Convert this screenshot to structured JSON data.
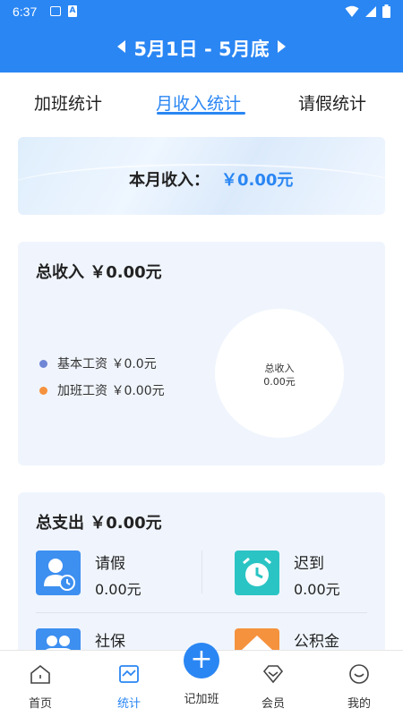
{
  "status_bar": {
    "time": "6:37"
  },
  "header": {
    "prev_icon": "triangle-left-icon",
    "date_range": "5月1日 - 5月底",
    "next_icon": "triangle-right-icon",
    "color": "#2a86f3"
  },
  "tabs": [
    {
      "label": "加班统计",
      "active": false
    },
    {
      "label": "月收入统计",
      "active": true
    },
    {
      "label": "请假统计",
      "active": false
    }
  ],
  "monthly_income": {
    "label": "本月收入：",
    "value": "￥0.00元"
  },
  "total_income": {
    "title": "总收入 ￥0.00元",
    "legend": [
      {
        "label": "基本工资 ￥0.0元",
        "color": "#6f86d6"
      },
      {
        "label": "加班工资 ￥0.00元",
        "color": "#f5923e"
      }
    ],
    "pie_center": {
      "label": "总收入",
      "value": "0.00元"
    }
  },
  "total_expense": {
    "title": "总支出 ￥0.00元",
    "items": [
      {
        "name": "请假",
        "amount": "0.00元",
        "icon": "person-clock-icon",
        "color": "#3d8ff0"
      },
      {
        "name": "迟到",
        "amount": "0.00元",
        "icon": "alarm-clock-icon",
        "color": "#2bc4c4"
      },
      {
        "name": "社保",
        "amount": "",
        "icon": "people-icon",
        "color": "#3d8ff0"
      },
      {
        "name": "公积金",
        "amount": "",
        "icon": "house-icon",
        "color": "#f5923e"
      }
    ]
  },
  "bottom_nav": {
    "items": [
      {
        "label": "首页",
        "icon": "home-icon",
        "active": false
      },
      {
        "label": "统计",
        "icon": "chart-icon",
        "active": true
      },
      {
        "label": "记加班",
        "icon": "plus-icon",
        "active": false
      },
      {
        "label": "会员",
        "icon": "diamond-icon",
        "active": false
      },
      {
        "label": "我的",
        "icon": "smile-icon",
        "active": false
      }
    ]
  }
}
